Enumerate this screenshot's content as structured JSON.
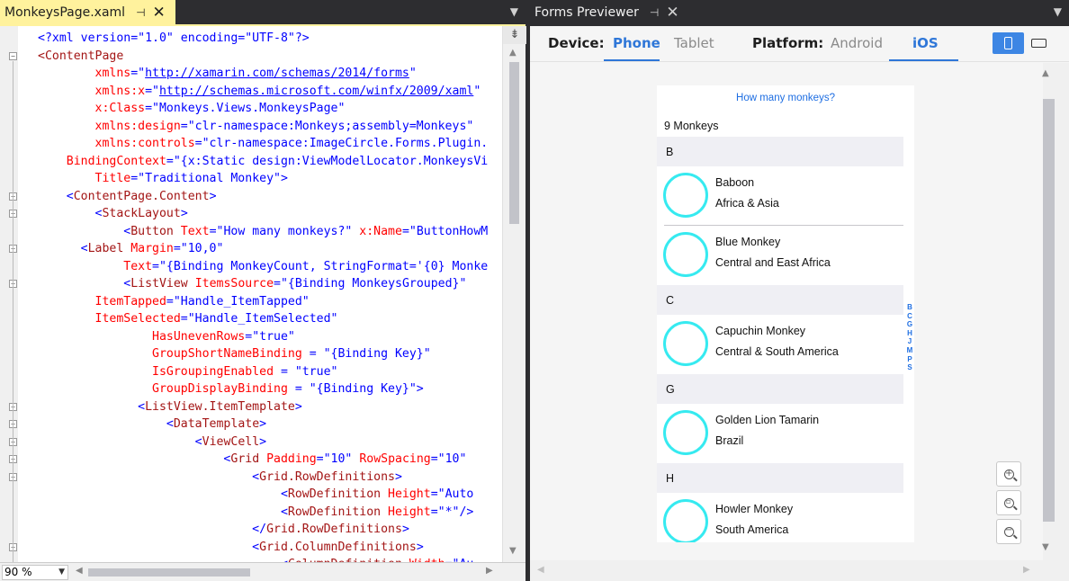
{
  "editor": {
    "tab_title": "MonkeysPage.xaml",
    "pin_glyph": "⊣",
    "close_glyph": "✕",
    "zoom": "90 %",
    "lines": [
      [
        [
          "v",
          "<?xml version=\"1.0\" encoding=\"UTF-8\"?>"
        ]
      ],
      [
        [
          "t",
          "<ContentPage"
        ]
      ],
      [
        [
          "a",
          "        xmlns"
        ],
        [
          "v",
          "=\""
        ],
        [
          "l",
          "http://xamarin.com/schemas/2014/forms"
        ],
        [
          "v",
          "\""
        ]
      ],
      [
        [
          "a",
          "        xmlns:x"
        ],
        [
          "v",
          "=\""
        ],
        [
          "l",
          "http://schemas.microsoft.com/winfx/2009/xaml"
        ],
        [
          "v",
          "\""
        ]
      ],
      [
        [
          "a",
          "        x:Class"
        ],
        [
          "v",
          "=\"Monkeys.Views.MonkeysPage\""
        ]
      ],
      [
        [
          "a",
          "        xmlns:design"
        ],
        [
          "v",
          "=\"clr-namespace:Monkeys;assembly=Monkeys\""
        ]
      ],
      [
        [
          "a",
          "        xmlns:controls"
        ],
        [
          "v",
          "=\"clr-namespace:ImageCircle.Forms.Plugin."
        ]
      ],
      [
        [
          "a",
          "    BindingContext"
        ],
        [
          "v",
          "=\"{x:Static design:ViewModelLocator.MonkeysVi"
        ]
      ],
      [
        [
          "a",
          "        Title"
        ],
        [
          "v",
          "=\"Traditional Monkey\">"
        ]
      ],
      [
        [
          "v",
          "    <"
        ],
        [
          "t",
          "ContentPage.Content"
        ],
        [
          "v",
          ">"
        ]
      ],
      [
        [
          "v",
          "        <"
        ],
        [
          "t",
          "StackLayout"
        ],
        [
          "v",
          ">"
        ]
      ],
      [
        [
          "v",
          "            <"
        ],
        [
          "t",
          "Button"
        ],
        [
          "a",
          " Text"
        ],
        [
          "v",
          "=\"How many monkeys?\""
        ],
        [
          "a",
          " x:Name"
        ],
        [
          "v",
          "=\"ButtonHowM"
        ]
      ],
      [
        [
          "v",
          "      <"
        ],
        [
          "t",
          "Label"
        ],
        [
          "a",
          " Margin"
        ],
        [
          "v",
          "=\"10,0\""
        ]
      ],
      [
        [
          "a",
          "            Text"
        ],
        [
          "v",
          "=\"{Binding MonkeyCount, StringFormat='{0} Monke"
        ]
      ],
      [
        [
          "v",
          "            <"
        ],
        [
          "t",
          "ListView"
        ],
        [
          "a",
          " ItemsSource"
        ],
        [
          "v",
          "=\"{Binding MonkeysGrouped}\""
        ]
      ],
      [
        [
          "a",
          "        ItemTapped"
        ],
        [
          "v",
          "=\"Handle_ItemTapped\""
        ]
      ],
      [
        [
          "a",
          "        ItemSelected"
        ],
        [
          "v",
          "=\"Handle_ItemSelected\""
        ]
      ],
      [
        [
          "a",
          "                HasUnevenRows"
        ],
        [
          "v",
          "=\"true\""
        ]
      ],
      [
        [
          "a",
          "                GroupShortNameBinding"
        ],
        [
          "v",
          " = \"{Binding Key}\""
        ]
      ],
      [
        [
          "a",
          "                IsGroupingEnabled"
        ],
        [
          "v",
          " = \"true\""
        ]
      ],
      [
        [
          "a",
          "                GroupDisplayBinding"
        ],
        [
          "v",
          " = \"{Binding Key}\">"
        ]
      ],
      [
        [
          "v",
          "              <"
        ],
        [
          "t",
          "ListView.ItemTemplate"
        ],
        [
          "v",
          ">"
        ]
      ],
      [
        [
          "v",
          "                  <"
        ],
        [
          "t",
          "DataTemplate"
        ],
        [
          "v",
          ">"
        ]
      ],
      [
        [
          "v",
          "                      <"
        ],
        [
          "t",
          "ViewCell"
        ],
        [
          "v",
          ">"
        ]
      ],
      [
        [
          "v",
          "                          <"
        ],
        [
          "t",
          "Grid"
        ],
        [
          "a",
          " Padding"
        ],
        [
          "v",
          "=\"10\""
        ],
        [
          "a",
          " RowSpacing"
        ],
        [
          "v",
          "=\"10\""
        ]
      ],
      [
        [
          "v",
          "                              <"
        ],
        [
          "t",
          "Grid.RowDefinitions"
        ],
        [
          "v",
          ">"
        ]
      ],
      [
        [
          "v",
          "                                  <"
        ],
        [
          "t",
          "RowDefinition"
        ],
        [
          "a",
          " Height"
        ],
        [
          "v",
          "=\"Auto"
        ]
      ],
      [
        [
          "v",
          "                                  <"
        ],
        [
          "t",
          "RowDefinition"
        ],
        [
          "a",
          " Height"
        ],
        [
          "v",
          "=\"*\"/>"
        ]
      ],
      [
        [
          "v",
          "                              </"
        ],
        [
          "t",
          "Grid.RowDefinitions"
        ],
        [
          "v",
          ">"
        ]
      ],
      [
        [
          "v",
          "                              <"
        ],
        [
          "t",
          "Grid.ColumnDefinitions"
        ],
        [
          "v",
          ">"
        ]
      ],
      [
        [
          "v",
          "                                  <"
        ],
        [
          "t",
          "ColumnDefinition"
        ],
        [
          "a",
          " Width"
        ],
        [
          "v",
          "=\"Au"
        ]
      ]
    ]
  },
  "previewer": {
    "tab_title": "Forms Previewer",
    "pin_glyph": "⊣",
    "close_glyph": "✕",
    "device_label": "Device:",
    "device_options": [
      "Phone",
      "Tablet"
    ],
    "device_selected": "Phone",
    "platform_label": "Platform:",
    "platform_options": [
      "Android",
      "iOS"
    ],
    "platform_selected": "iOS",
    "accent_color": "#2f77d8",
    "app": {
      "button_text": "How many monkeys?",
      "count_text": "9 Monkeys",
      "index_letters": [
        "B",
        "C",
        "G",
        "H",
        "J",
        "M",
        "P",
        "S"
      ],
      "groups": [
        {
          "key": "B",
          "items": [
            {
              "name": "Baboon",
              "location": "Africa & Asia"
            },
            {
              "name": "Blue Monkey",
              "location": "Central and East Africa"
            }
          ]
        },
        {
          "key": "C",
          "items": [
            {
              "name": "Capuchin Monkey",
              "location": "Central & South America"
            }
          ]
        },
        {
          "key": "G",
          "items": [
            {
              "name": "Golden Lion Tamarin",
              "location": "Brazil"
            }
          ]
        },
        {
          "key": "H",
          "items": [
            {
              "name": "Howler Monkey",
              "location": "South America"
            }
          ]
        }
      ]
    },
    "zoom_controls": [
      "zoom-in",
      "zoom-to-fit",
      "zoom-out"
    ]
  }
}
